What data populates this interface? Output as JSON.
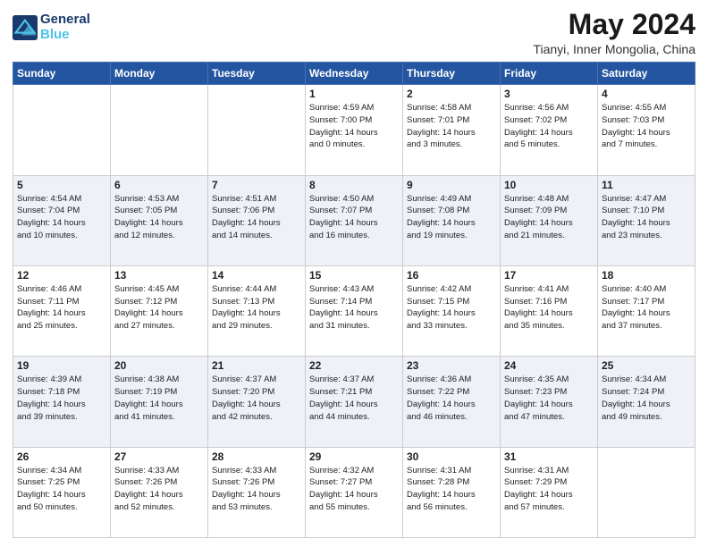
{
  "logo": {
    "line1": "General",
    "line2": "Blue"
  },
  "title": "May 2024",
  "location": "Tianyi, Inner Mongolia, China",
  "days_header": [
    "Sunday",
    "Monday",
    "Tuesday",
    "Wednesday",
    "Thursday",
    "Friday",
    "Saturday"
  ],
  "weeks": [
    [
      {
        "num": "",
        "lines": []
      },
      {
        "num": "",
        "lines": []
      },
      {
        "num": "",
        "lines": []
      },
      {
        "num": "1",
        "lines": [
          "Sunrise: 4:59 AM",
          "Sunset: 7:00 PM",
          "Daylight: 14 hours",
          "and 0 minutes."
        ]
      },
      {
        "num": "2",
        "lines": [
          "Sunrise: 4:58 AM",
          "Sunset: 7:01 PM",
          "Daylight: 14 hours",
          "and 3 minutes."
        ]
      },
      {
        "num": "3",
        "lines": [
          "Sunrise: 4:56 AM",
          "Sunset: 7:02 PM",
          "Daylight: 14 hours",
          "and 5 minutes."
        ]
      },
      {
        "num": "4",
        "lines": [
          "Sunrise: 4:55 AM",
          "Sunset: 7:03 PM",
          "Daylight: 14 hours",
          "and 7 minutes."
        ]
      }
    ],
    [
      {
        "num": "5",
        "lines": [
          "Sunrise: 4:54 AM",
          "Sunset: 7:04 PM",
          "Daylight: 14 hours",
          "and 10 minutes."
        ]
      },
      {
        "num": "6",
        "lines": [
          "Sunrise: 4:53 AM",
          "Sunset: 7:05 PM",
          "Daylight: 14 hours",
          "and 12 minutes."
        ]
      },
      {
        "num": "7",
        "lines": [
          "Sunrise: 4:51 AM",
          "Sunset: 7:06 PM",
          "Daylight: 14 hours",
          "and 14 minutes."
        ]
      },
      {
        "num": "8",
        "lines": [
          "Sunrise: 4:50 AM",
          "Sunset: 7:07 PM",
          "Daylight: 14 hours",
          "and 16 minutes."
        ]
      },
      {
        "num": "9",
        "lines": [
          "Sunrise: 4:49 AM",
          "Sunset: 7:08 PM",
          "Daylight: 14 hours",
          "and 19 minutes."
        ]
      },
      {
        "num": "10",
        "lines": [
          "Sunrise: 4:48 AM",
          "Sunset: 7:09 PM",
          "Daylight: 14 hours",
          "and 21 minutes."
        ]
      },
      {
        "num": "11",
        "lines": [
          "Sunrise: 4:47 AM",
          "Sunset: 7:10 PM",
          "Daylight: 14 hours",
          "and 23 minutes."
        ]
      }
    ],
    [
      {
        "num": "12",
        "lines": [
          "Sunrise: 4:46 AM",
          "Sunset: 7:11 PM",
          "Daylight: 14 hours",
          "and 25 minutes."
        ]
      },
      {
        "num": "13",
        "lines": [
          "Sunrise: 4:45 AM",
          "Sunset: 7:12 PM",
          "Daylight: 14 hours",
          "and 27 minutes."
        ]
      },
      {
        "num": "14",
        "lines": [
          "Sunrise: 4:44 AM",
          "Sunset: 7:13 PM",
          "Daylight: 14 hours",
          "and 29 minutes."
        ]
      },
      {
        "num": "15",
        "lines": [
          "Sunrise: 4:43 AM",
          "Sunset: 7:14 PM",
          "Daylight: 14 hours",
          "and 31 minutes."
        ]
      },
      {
        "num": "16",
        "lines": [
          "Sunrise: 4:42 AM",
          "Sunset: 7:15 PM",
          "Daylight: 14 hours",
          "and 33 minutes."
        ]
      },
      {
        "num": "17",
        "lines": [
          "Sunrise: 4:41 AM",
          "Sunset: 7:16 PM",
          "Daylight: 14 hours",
          "and 35 minutes."
        ]
      },
      {
        "num": "18",
        "lines": [
          "Sunrise: 4:40 AM",
          "Sunset: 7:17 PM",
          "Daylight: 14 hours",
          "and 37 minutes."
        ]
      }
    ],
    [
      {
        "num": "19",
        "lines": [
          "Sunrise: 4:39 AM",
          "Sunset: 7:18 PM",
          "Daylight: 14 hours",
          "and 39 minutes."
        ]
      },
      {
        "num": "20",
        "lines": [
          "Sunrise: 4:38 AM",
          "Sunset: 7:19 PM",
          "Daylight: 14 hours",
          "and 41 minutes."
        ]
      },
      {
        "num": "21",
        "lines": [
          "Sunrise: 4:37 AM",
          "Sunset: 7:20 PM",
          "Daylight: 14 hours",
          "and 42 minutes."
        ]
      },
      {
        "num": "22",
        "lines": [
          "Sunrise: 4:37 AM",
          "Sunset: 7:21 PM",
          "Daylight: 14 hours",
          "and 44 minutes."
        ]
      },
      {
        "num": "23",
        "lines": [
          "Sunrise: 4:36 AM",
          "Sunset: 7:22 PM",
          "Daylight: 14 hours",
          "and 46 minutes."
        ]
      },
      {
        "num": "24",
        "lines": [
          "Sunrise: 4:35 AM",
          "Sunset: 7:23 PM",
          "Daylight: 14 hours",
          "and 47 minutes."
        ]
      },
      {
        "num": "25",
        "lines": [
          "Sunrise: 4:34 AM",
          "Sunset: 7:24 PM",
          "Daylight: 14 hours",
          "and 49 minutes."
        ]
      }
    ],
    [
      {
        "num": "26",
        "lines": [
          "Sunrise: 4:34 AM",
          "Sunset: 7:25 PM",
          "Daylight: 14 hours",
          "and 50 minutes."
        ]
      },
      {
        "num": "27",
        "lines": [
          "Sunrise: 4:33 AM",
          "Sunset: 7:26 PM",
          "Daylight: 14 hours",
          "and 52 minutes."
        ]
      },
      {
        "num": "28",
        "lines": [
          "Sunrise: 4:33 AM",
          "Sunset: 7:26 PM",
          "Daylight: 14 hours",
          "and 53 minutes."
        ]
      },
      {
        "num": "29",
        "lines": [
          "Sunrise: 4:32 AM",
          "Sunset: 7:27 PM",
          "Daylight: 14 hours",
          "and 55 minutes."
        ]
      },
      {
        "num": "30",
        "lines": [
          "Sunrise: 4:31 AM",
          "Sunset: 7:28 PM",
          "Daylight: 14 hours",
          "and 56 minutes."
        ]
      },
      {
        "num": "31",
        "lines": [
          "Sunrise: 4:31 AM",
          "Sunset: 7:29 PM",
          "Daylight: 14 hours",
          "and 57 minutes."
        ]
      },
      {
        "num": "",
        "lines": []
      }
    ]
  ]
}
